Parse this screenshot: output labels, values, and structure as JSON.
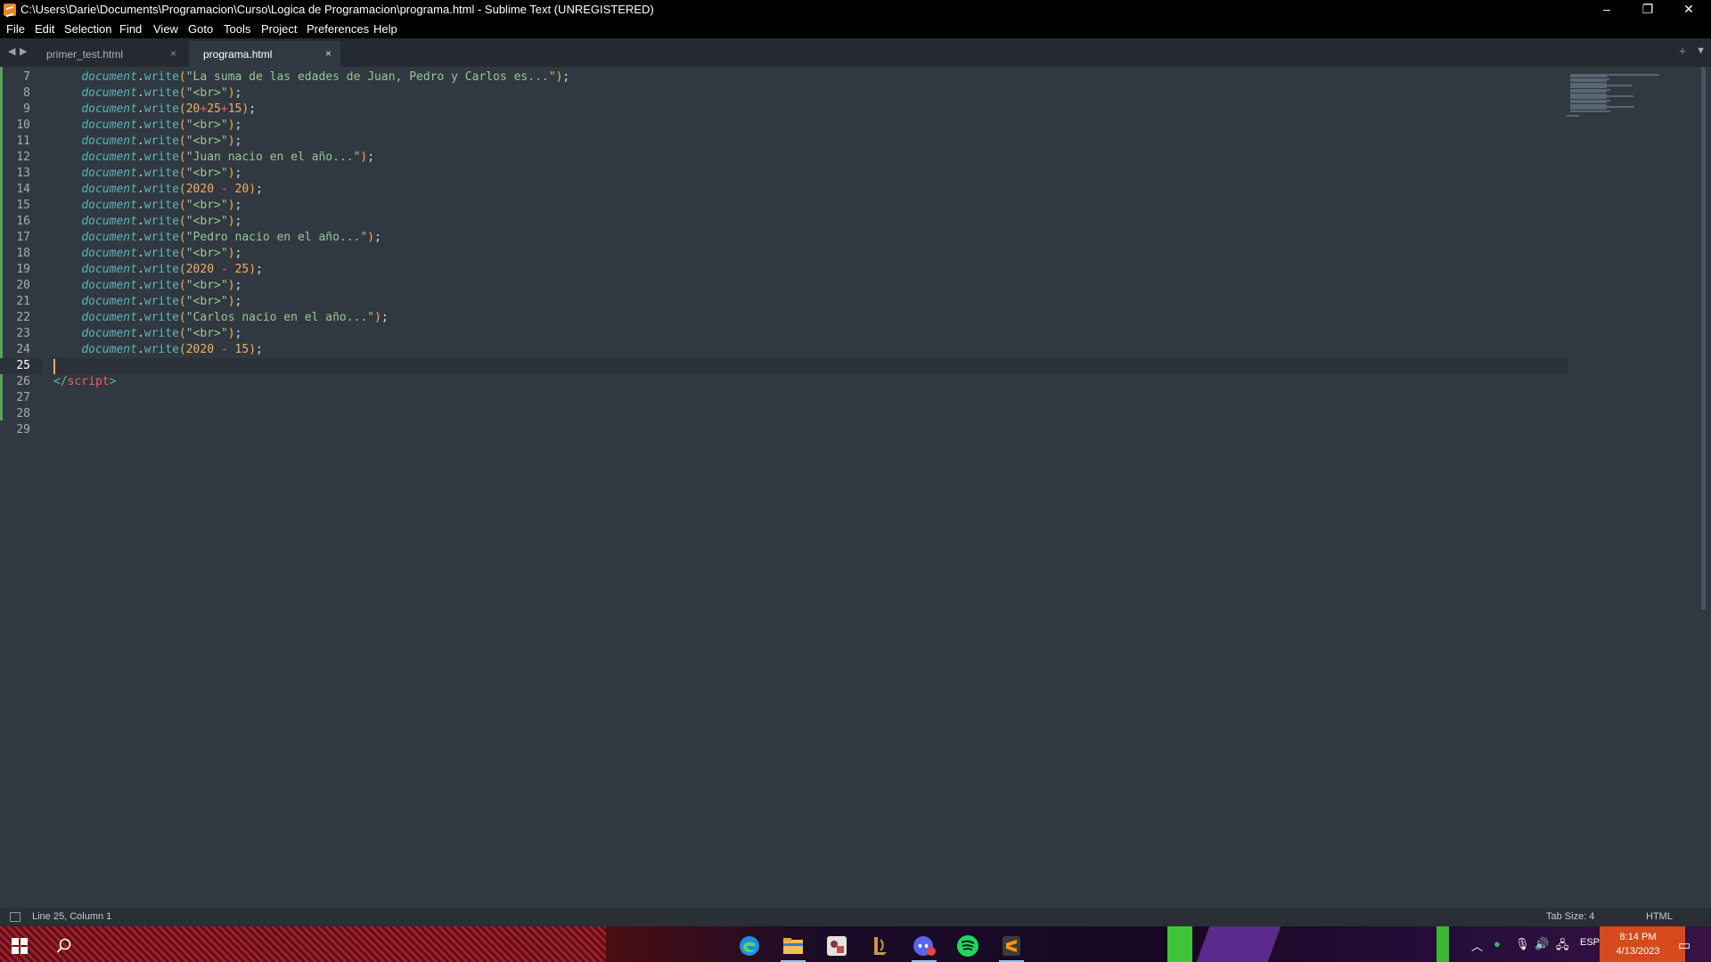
{
  "window": {
    "title": "C:\\Users\\Darie\\Documents\\Programacion\\Curso\\Logica de Programacion\\programa.html - Sublime Text (UNREGISTERED)",
    "minimize": "–",
    "restore": "❐",
    "close": "✕"
  },
  "menu": [
    "File",
    "Edit",
    "Selection",
    "Find",
    "View",
    "Goto",
    "Tools",
    "Project",
    "Preferences",
    "Help"
  ],
  "tabs": [
    {
      "label": "primer_test.html",
      "close": "×",
      "active": false
    },
    {
      "label": "programa.html",
      "close": "×",
      "active": true
    }
  ],
  "tabbar": {
    "left_arrow": "◀",
    "right_arrow": "▶",
    "new_tab": "+",
    "dropdown": "▼"
  },
  "editor": {
    "current_line": 25,
    "lines": [
      {
        "n": "7",
        "tokens": [
          [
            "tok-punc",
            "    "
          ],
          [
            "tok-obj",
            "document"
          ],
          [
            "tok-dot",
            "."
          ],
          [
            "tok-fn",
            "write"
          ],
          [
            "tok-paren",
            "("
          ],
          [
            "tok-str",
            "\"La suma de las edades de Juan, Pedro y Carlos es...\""
          ],
          [
            "tok-paren",
            ")"
          ],
          [
            "tok-punc",
            ";"
          ]
        ]
      },
      {
        "n": "8",
        "tokens": [
          [
            "tok-punc",
            "    "
          ],
          [
            "tok-obj",
            "document"
          ],
          [
            "tok-dot",
            "."
          ],
          [
            "tok-fn",
            "write"
          ],
          [
            "tok-paren",
            "("
          ],
          [
            "tok-str",
            "\"<br>\""
          ],
          [
            "tok-paren",
            ")"
          ],
          [
            "tok-punc",
            ";"
          ]
        ]
      },
      {
        "n": "9",
        "tokens": [
          [
            "tok-punc",
            "    "
          ],
          [
            "tok-obj",
            "document"
          ],
          [
            "tok-dot",
            "."
          ],
          [
            "tok-fn",
            "write"
          ],
          [
            "tok-paren",
            "("
          ],
          [
            "tok-num",
            "20"
          ],
          [
            "tok-op",
            "+"
          ],
          [
            "tok-num",
            "25"
          ],
          [
            "tok-op",
            "+"
          ],
          [
            "tok-num",
            "15"
          ],
          [
            "tok-paren",
            ")"
          ],
          [
            "tok-punc",
            ";"
          ]
        ]
      },
      {
        "n": "10",
        "tokens": [
          [
            "tok-punc",
            "    "
          ],
          [
            "tok-obj",
            "document"
          ],
          [
            "tok-dot",
            "."
          ],
          [
            "tok-fn",
            "write"
          ],
          [
            "tok-paren",
            "("
          ],
          [
            "tok-str",
            "\"<br>\""
          ],
          [
            "tok-paren",
            ")"
          ],
          [
            "tok-punc",
            ";"
          ]
        ]
      },
      {
        "n": "11",
        "tokens": [
          [
            "tok-punc",
            "    "
          ],
          [
            "tok-obj",
            "document"
          ],
          [
            "tok-dot",
            "."
          ],
          [
            "tok-fn",
            "write"
          ],
          [
            "tok-paren",
            "("
          ],
          [
            "tok-str",
            "\"<br>\""
          ],
          [
            "tok-paren",
            ")"
          ],
          [
            "tok-punc",
            ";"
          ]
        ]
      },
      {
        "n": "12",
        "tokens": [
          [
            "tok-punc",
            "    "
          ],
          [
            "tok-obj",
            "document"
          ],
          [
            "tok-dot",
            "."
          ],
          [
            "tok-fn",
            "write"
          ],
          [
            "tok-paren",
            "("
          ],
          [
            "tok-str",
            "\"Juan nacio en el año...\""
          ],
          [
            "tok-paren",
            ")"
          ],
          [
            "tok-punc",
            ";"
          ]
        ]
      },
      {
        "n": "13",
        "tokens": [
          [
            "tok-punc",
            "    "
          ],
          [
            "tok-obj",
            "document"
          ],
          [
            "tok-dot",
            "."
          ],
          [
            "tok-fn",
            "write"
          ],
          [
            "tok-paren",
            "("
          ],
          [
            "tok-str",
            "\"<br>\""
          ],
          [
            "tok-paren",
            ")"
          ],
          [
            "tok-punc",
            ";"
          ]
        ]
      },
      {
        "n": "14",
        "tokens": [
          [
            "tok-punc",
            "    "
          ],
          [
            "tok-obj",
            "document"
          ],
          [
            "tok-dot",
            "."
          ],
          [
            "tok-fn",
            "write"
          ],
          [
            "tok-paren",
            "("
          ],
          [
            "tok-num",
            "2020"
          ],
          [
            "tok-punc",
            " "
          ],
          [
            "tok-op",
            "-"
          ],
          [
            "tok-punc",
            " "
          ],
          [
            "tok-num",
            "20"
          ],
          [
            "tok-paren",
            ")"
          ],
          [
            "tok-punc",
            ";"
          ]
        ]
      },
      {
        "n": "15",
        "tokens": [
          [
            "tok-punc",
            "    "
          ],
          [
            "tok-obj",
            "document"
          ],
          [
            "tok-dot",
            "."
          ],
          [
            "tok-fn",
            "write"
          ],
          [
            "tok-paren",
            "("
          ],
          [
            "tok-str",
            "\"<br>\""
          ],
          [
            "tok-paren",
            ")"
          ],
          [
            "tok-punc",
            ";"
          ]
        ]
      },
      {
        "n": "16",
        "tokens": [
          [
            "tok-punc",
            "    "
          ],
          [
            "tok-obj",
            "document"
          ],
          [
            "tok-dot",
            "."
          ],
          [
            "tok-fn",
            "write"
          ],
          [
            "tok-paren",
            "("
          ],
          [
            "tok-str",
            "\"<br>\""
          ],
          [
            "tok-paren",
            ")"
          ],
          [
            "tok-punc",
            ";"
          ]
        ]
      },
      {
        "n": "17",
        "tokens": [
          [
            "tok-punc",
            "    "
          ],
          [
            "tok-obj",
            "document"
          ],
          [
            "tok-dot",
            "."
          ],
          [
            "tok-fn",
            "write"
          ],
          [
            "tok-paren",
            "("
          ],
          [
            "tok-str",
            "\"Pedro nacio en el año...\""
          ],
          [
            "tok-paren",
            ")"
          ],
          [
            "tok-punc",
            ";"
          ]
        ]
      },
      {
        "n": "18",
        "tokens": [
          [
            "tok-punc",
            "    "
          ],
          [
            "tok-obj",
            "document"
          ],
          [
            "tok-dot",
            "."
          ],
          [
            "tok-fn",
            "write"
          ],
          [
            "tok-paren",
            "("
          ],
          [
            "tok-str",
            "\"<br>\""
          ],
          [
            "tok-paren",
            ")"
          ],
          [
            "tok-punc",
            ";"
          ]
        ]
      },
      {
        "n": "19",
        "tokens": [
          [
            "tok-punc",
            "    "
          ],
          [
            "tok-obj",
            "document"
          ],
          [
            "tok-dot",
            "."
          ],
          [
            "tok-fn",
            "write"
          ],
          [
            "tok-paren",
            "("
          ],
          [
            "tok-num",
            "2020"
          ],
          [
            "tok-punc",
            " "
          ],
          [
            "tok-op",
            "-"
          ],
          [
            "tok-punc",
            " "
          ],
          [
            "tok-num",
            "25"
          ],
          [
            "tok-paren",
            ")"
          ],
          [
            "tok-punc",
            ";"
          ]
        ]
      },
      {
        "n": "20",
        "tokens": [
          [
            "tok-punc",
            "    "
          ],
          [
            "tok-obj",
            "document"
          ],
          [
            "tok-dot",
            "."
          ],
          [
            "tok-fn",
            "write"
          ],
          [
            "tok-paren",
            "("
          ],
          [
            "tok-str",
            "\"<br>\""
          ],
          [
            "tok-paren",
            ")"
          ],
          [
            "tok-punc",
            ";"
          ]
        ]
      },
      {
        "n": "21",
        "tokens": [
          [
            "tok-punc",
            "    "
          ],
          [
            "tok-obj",
            "document"
          ],
          [
            "tok-dot",
            "."
          ],
          [
            "tok-fn",
            "write"
          ],
          [
            "tok-paren",
            "("
          ],
          [
            "tok-str",
            "\"<br>\""
          ],
          [
            "tok-paren",
            ")"
          ],
          [
            "tok-punc",
            ";"
          ]
        ]
      },
      {
        "n": "22",
        "tokens": [
          [
            "tok-punc",
            "    "
          ],
          [
            "tok-obj",
            "document"
          ],
          [
            "tok-dot",
            "."
          ],
          [
            "tok-fn",
            "write"
          ],
          [
            "tok-paren",
            "("
          ],
          [
            "tok-str",
            "\"Carlos nacio en el año...\""
          ],
          [
            "tok-paren",
            ")"
          ],
          [
            "tok-punc",
            ";"
          ]
        ]
      },
      {
        "n": "23",
        "tokens": [
          [
            "tok-punc",
            "    "
          ],
          [
            "tok-obj",
            "document"
          ],
          [
            "tok-dot",
            "."
          ],
          [
            "tok-fn",
            "write"
          ],
          [
            "tok-paren",
            "("
          ],
          [
            "tok-str",
            "\"<br>\""
          ],
          [
            "tok-paren",
            ")"
          ],
          [
            "tok-punc",
            ";"
          ]
        ]
      },
      {
        "n": "24",
        "tokens": [
          [
            "tok-punc",
            "    "
          ],
          [
            "tok-obj",
            "document"
          ],
          [
            "tok-dot",
            "."
          ],
          [
            "tok-fn",
            "write"
          ],
          [
            "tok-paren",
            "("
          ],
          [
            "tok-num",
            "2020"
          ],
          [
            "tok-punc",
            " "
          ],
          [
            "tok-op",
            "-"
          ],
          [
            "tok-punc",
            " "
          ],
          [
            "tok-num",
            "15"
          ],
          [
            "tok-paren",
            ")"
          ],
          [
            "tok-punc",
            ";"
          ]
        ]
      },
      {
        "n": "25",
        "tokens": []
      },
      {
        "n": "26",
        "tokens": [
          [
            "tok-tagp",
            "</"
          ],
          [
            "tok-tag",
            "script"
          ],
          [
            "tok-tagp",
            ">"
          ]
        ]
      },
      {
        "n": "27",
        "tokens": []
      },
      {
        "n": "28",
        "tokens": []
      },
      {
        "n": "29",
        "tokens": []
      }
    ]
  },
  "status": {
    "position": "Line 25, Column 1",
    "tab_size": "Tab Size: 4",
    "syntax": "HTML"
  },
  "taskbar": {
    "start_icon": "windows-start-icon",
    "apps": [
      "search-icon",
      "edge-icon",
      "file-explorer-icon",
      "app-icon",
      "league-client-icon",
      "discord-icon",
      "spotify-icon",
      "sublime-text-icon"
    ],
    "tray": {
      "language": "ESP",
      "time": "8:14 PM",
      "date": "4/13/2023"
    }
  }
}
